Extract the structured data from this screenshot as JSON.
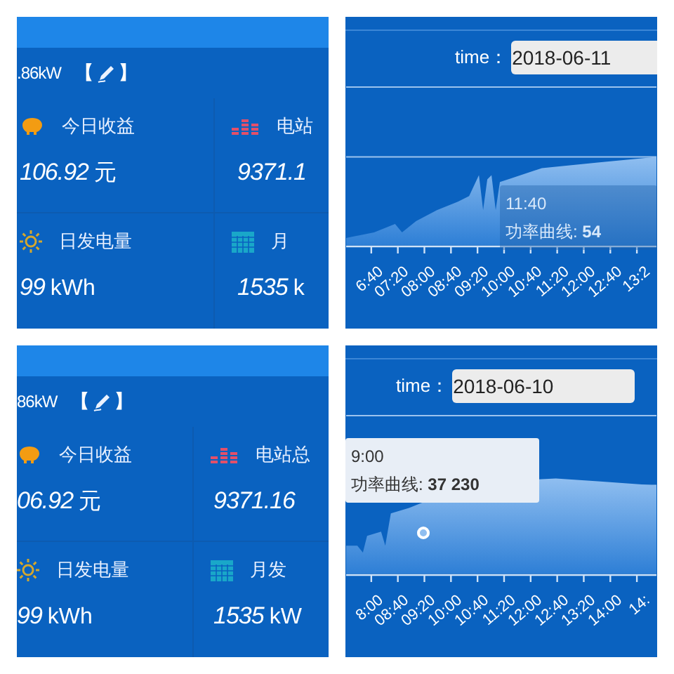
{
  "panels": [
    {
      "kind": "stats",
      "power": ".86kW",
      "edit_open": "【",
      "edit_close": "】",
      "stats": [
        {
          "kind": "piggy",
          "label": "今日收益",
          "value": "106.92",
          "unit": "元"
        },
        {
          "kind": "bars",
          "label": "电站",
          "value": "9371.1"
        },
        {
          "kind": "sun",
          "label": "日发电量",
          "value": "99",
          "unit": "kWh"
        },
        {
          "kind": "calendar",
          "label": "月",
          "value": "1535",
          "unit": "k"
        }
      ]
    },
    {
      "kind": "chart",
      "time_label": "time：",
      "date": "2018-06-11",
      "x_labels": [
        "6:40",
        "07:20",
        "08:00",
        "08:40",
        "09:20",
        "10:00",
        "10:40",
        "11:20",
        "12:00",
        "12:40",
        "13:2"
      ],
      "tooltip": {
        "time": "11:40",
        "series": "功率曲线:",
        "value": "54",
        "faded": true
      }
    },
    {
      "kind": "stats",
      "power": "86kW",
      "edit_open": "【",
      "edit_close": "】",
      "stats": [
        {
          "kind": "piggy",
          "label": "今日收益",
          "value": "06.92",
          "unit": "元"
        },
        {
          "kind": "bars",
          "label": "电站总",
          "value": "9371.16"
        },
        {
          "kind": "sun",
          "label": "日发电量",
          "value": "99",
          "unit": "kWh"
        },
        {
          "kind": "calendar",
          "label": "月发",
          "value": "1535",
          "unit": "kW"
        }
      ]
    },
    {
      "kind": "chart",
      "time_label": "time：",
      "date": "2018-06-10",
      "x_labels": [
        "8:00",
        "08:40",
        "09:20",
        "10:00",
        "10:40",
        "11:20",
        "12:00",
        "12:40",
        "13:20",
        "14:00",
        "14:"
      ],
      "tooltip": {
        "time": "9:00",
        "series": "功率曲线:",
        "value": "37 230",
        "faded": false
      }
    }
  ]
}
